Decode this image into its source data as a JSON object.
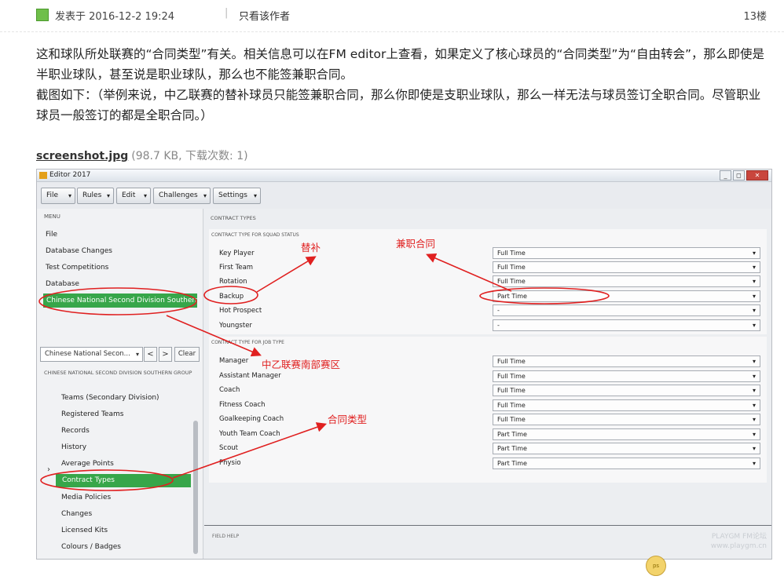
{
  "post": {
    "posted_at": "发表于 2016-12-2 19:24",
    "separator": "|",
    "author_only": "只看该作者",
    "floor": "13楼",
    "paragraphs": [
      "这和球队所处联赛的“合同类型”有关。相关信息可以在FM editor上查看，如果定义了核心球员的“合同类型”为“自由转会”，那么即使是半职业球队，甚至说是职业球队，那么也不能签兼职合同。",
      "截图如下：（举例来说，中乙联赛的替补球员只能签兼职合同，那么你即使是支职业球队，那么一样无法与球员签订全职合同。尽管职业球员一般签订的都是全职合同。）"
    ],
    "attachment": {
      "name": "screenshot.jpg",
      "meta": "(98.7 KB, 下载次数: 1)"
    }
  },
  "editor": {
    "title": "Editor 2017",
    "window_buttons": {
      "minimize": "_",
      "restore": "◻",
      "close": "✕"
    },
    "toolbar": [
      "File",
      "Rules",
      "Edit",
      "Challenges",
      "Settings"
    ],
    "menu_label": "MENU",
    "menu_items": [
      "File",
      "Database Changes",
      "Test Competitions",
      "Database"
    ],
    "selected_competition": "Chinese National Second Division Southern Group",
    "competition_select": "Chinese National Secon...",
    "nav_prev": "<",
    "nav_next": ">",
    "clear_label": "Clear",
    "group_label": "CHINESE NATIONAL SECOND DIVISION SOUTHERN GROUP",
    "sub_items": [
      "Teams (Secondary Division)",
      "Registered Teams",
      "Records",
      "History",
      "Average Points",
      "Contract Types",
      "Media Policies",
      "Changes",
      "Licensed Kits",
      "Colours / Badges"
    ],
    "selected_sub_item": "Contract Types",
    "section_title": "CONTRACT TYPES",
    "squad_group_label": "CONTRACT TYPE FOR SQUAD STATUS",
    "squad_rows": [
      {
        "label": "Key Player",
        "value": "Full Time"
      },
      {
        "label": "First Team",
        "value": "Full Time"
      },
      {
        "label": "Rotation",
        "value": "Full Time"
      },
      {
        "label": "Backup",
        "value": "Part Time"
      },
      {
        "label": "Hot Prospect",
        "value": "-"
      },
      {
        "label": "Youngster",
        "value": "-"
      }
    ],
    "job_group_label": "CONTRACT TYPE FOR JOB TYPE",
    "job_rows": [
      {
        "label": "Manager",
        "value": "Full Time"
      },
      {
        "label": "Assistant Manager",
        "value": "Full Time"
      },
      {
        "label": "Coach",
        "value": "Full Time"
      },
      {
        "label": "Fitness Coach",
        "value": "Full Time"
      },
      {
        "label": "Goalkeeping Coach",
        "value": "Full Time"
      },
      {
        "label": "Youth Team Coach",
        "value": "Part Time"
      },
      {
        "label": "Scout",
        "value": "Part Time"
      },
      {
        "label": "Physio",
        "value": "Part Time"
      }
    ],
    "field_help": "FIELD HELP",
    "watermark": "PLAYGM FM论坛\nwww.playgm.cn"
  },
  "annotations": {
    "backup": "替补",
    "part_time": "兼职合同",
    "league": "中乙联赛南部赛区",
    "contract_type": "合同类型",
    "color": "#e02020"
  },
  "colors": {
    "selected_green": "#37a64a",
    "annotation_red": "#e02020"
  }
}
